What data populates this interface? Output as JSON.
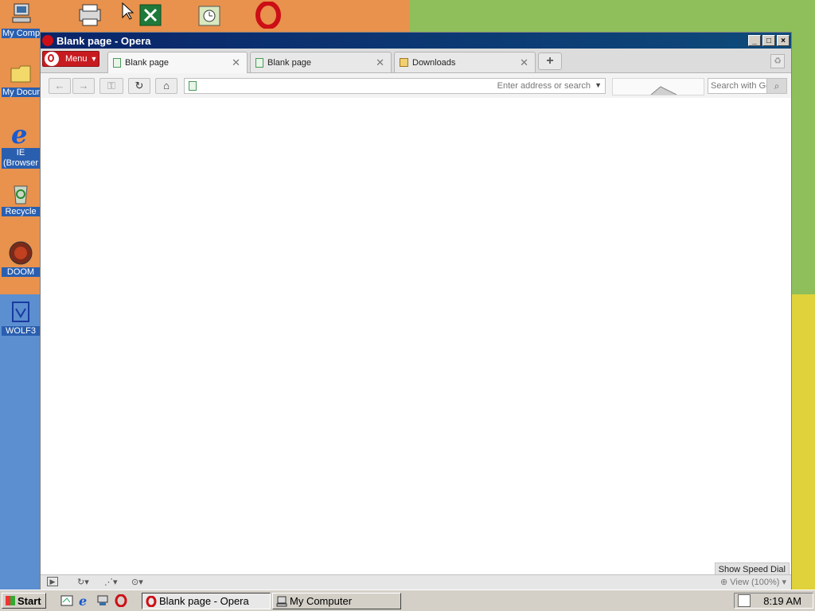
{
  "desktop": {
    "icons": [
      {
        "label": "My Comp",
        "icon": "my-computer-icon"
      },
      {
        "label": "My Docun",
        "icon": "my-documents-icon"
      },
      {
        "label": "IE (Browser",
        "icon": "internet-explorer-icon"
      },
      {
        "label": "Recycle",
        "icon": "recycle-bin-icon"
      },
      {
        "label": "DOOM",
        "icon": "doom-icon"
      },
      {
        "label": "WOLF3",
        "icon": "wolf3d-icon"
      }
    ],
    "top_icons": [
      "network-printer-icon",
      "cursor-icon",
      "excel-icon",
      "clock-app-icon",
      "opera-icon"
    ]
  },
  "window": {
    "title": "Blank page - Opera",
    "menu_label": "Menu",
    "tabs": [
      {
        "label": "Blank page",
        "active": true
      },
      {
        "label": "Blank page",
        "active": false
      },
      {
        "label": "Downloads",
        "active": false
      }
    ],
    "address_placeholder": "Enter address or search",
    "search_placeholder": "Search with Go",
    "speed_dial_label": "Show Speed Dial",
    "zoom_label": "View (100%)"
  },
  "taskbar": {
    "start_label": "Start",
    "tasks": [
      {
        "label": "Blank page - Opera",
        "active": true
      },
      {
        "label": "My Computer",
        "active": false
      }
    ],
    "clock": "8:19 AM"
  },
  "colors": {
    "opera_red": "#cc0f16",
    "title_blue": "#0a246a"
  }
}
